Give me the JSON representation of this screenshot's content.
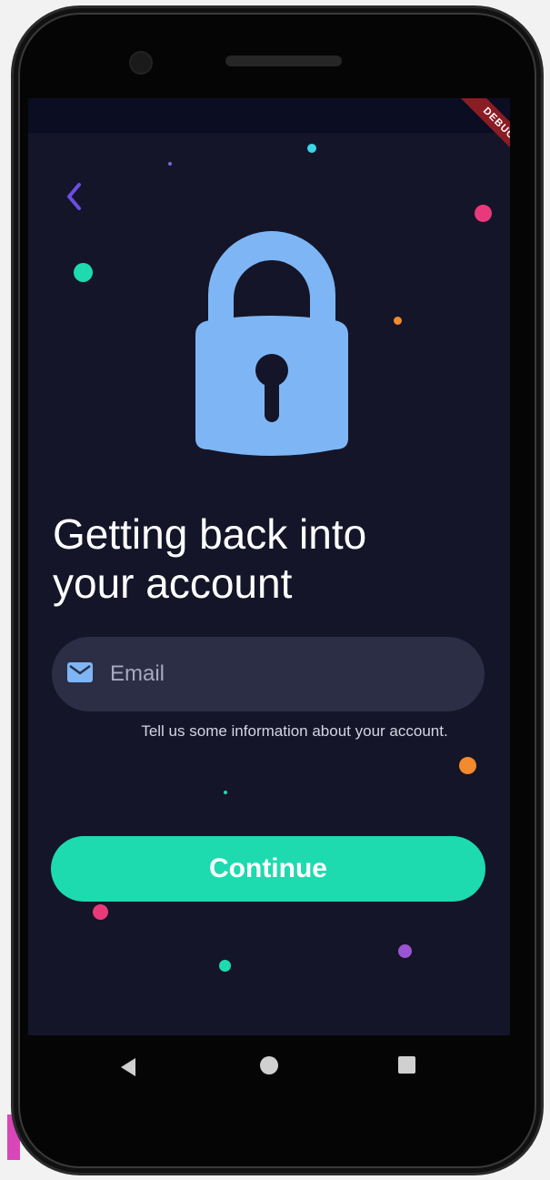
{
  "heading": {
    "line1": "Getting back into",
    "line2": "your account"
  },
  "email_field": {
    "placeholder": "Email",
    "icon": "mail-icon"
  },
  "helper_text": "Tell us some information about your account.",
  "continue_button": {
    "label": "Continue"
  },
  "debug_banner": "DEBUG",
  "icons": {
    "back": "chevron-left-icon",
    "lock": "lock-icon",
    "nav_back": "triangle-back-icon",
    "nav_home": "circle-home-icon",
    "nav_recents": "square-recents-icon"
  },
  "colors": {
    "background": "#141528",
    "accent": "#1edaaf",
    "lock": "#7eb6f5",
    "input_bg": "#2c2e46",
    "back_chevron": "#6b4ee6"
  }
}
